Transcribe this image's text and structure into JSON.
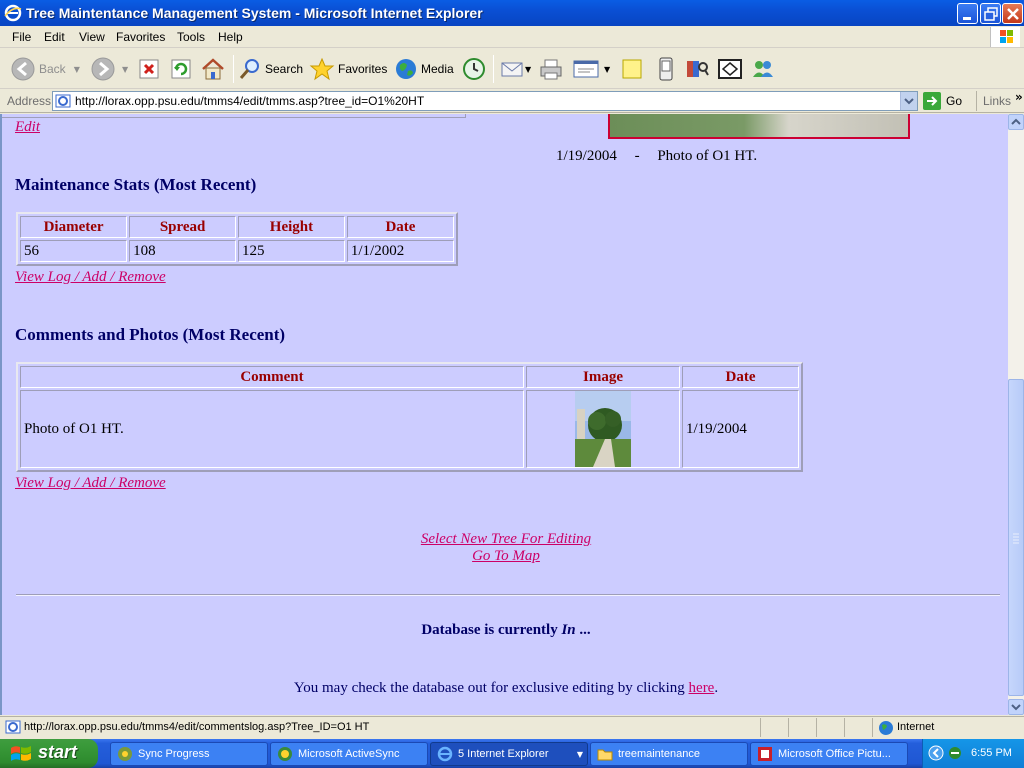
{
  "window": {
    "title": "Tree Maintentance Management System - Microsoft Internet Explorer"
  },
  "menu": [
    "File",
    "Edit",
    "View",
    "Favorites",
    "Tools",
    "Help"
  ],
  "toolbar": {
    "back": "Back",
    "search": "Search",
    "favorites": "Favorites",
    "media": "Media"
  },
  "address": {
    "label": "Address",
    "url": "http://lorax.opp.psu.edu/tmms4/edit/tmms.asp?tree_id=O1%20HT",
    "go": "Go",
    "links": "Links"
  },
  "page": {
    "edit_link": "Edit",
    "photo_caption_date": "1/19/2004",
    "photo_caption_sep": "-",
    "photo_caption_text": "Photo of O1 HT.",
    "maintenance": {
      "heading": "Maintenance Stats (Most Recent)",
      "headers": [
        "Diameter",
        "Spread",
        "Height",
        "Date"
      ],
      "row": [
        "56",
        "108",
        "125",
        "1/1/2002"
      ],
      "link": "View Log / Add / Remove"
    },
    "comments": {
      "heading": "Comments and Photos (Most Recent)",
      "headers": [
        "Comment",
        "Image",
        "Date"
      ],
      "comment": "Photo of O1 HT.",
      "date": "1/19/2004",
      "link": "View Log / Add / Remove"
    },
    "select_new_tree": "Select New Tree For Editing",
    "go_to_map": "Go To Map",
    "db_status_prefix": "Database is currently",
    "db_status_value": "In",
    "db_status_suffix": "...",
    "checkout_text": "You may check the database out for exclusive editing by clicking",
    "checkout_link": "here",
    "checkout_end": "."
  },
  "status": {
    "url": "http://lorax.opp.psu.edu/tmms4/edit/commentslog.asp?Tree_ID=O1 HT",
    "zone": "Internet"
  },
  "taskbar": {
    "start": "start",
    "tasks": [
      "Sync Progress",
      "Microsoft ActiveSync",
      "5 Internet Explorer",
      "treemaintenance",
      "Microsoft Office Pictu..."
    ],
    "clock": "6:55 PM"
  },
  "colors": {
    "page_bg": "#ccccff",
    "heading": "#000066",
    "table_header": "#990000",
    "link": "#cc0066"
  }
}
